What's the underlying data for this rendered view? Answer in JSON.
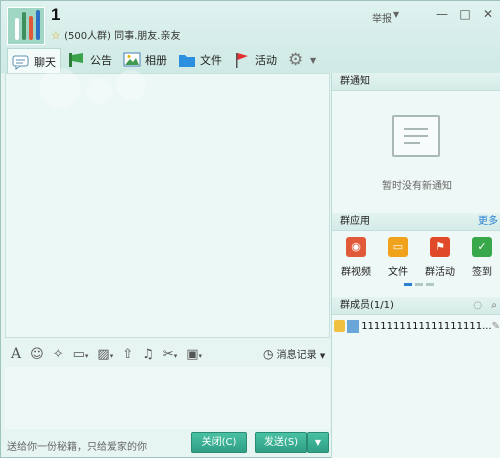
{
  "window": {
    "group_name": "1",
    "group_meta": "(500人群) 同事.朋友.亲友",
    "report_label": "举报",
    "minimize": "—",
    "maximize": "□",
    "close": "✕"
  },
  "tabs": [
    {
      "label": "聊天",
      "icon": "chat-bubble-icon"
    },
    {
      "label": "公告",
      "icon": "megaphone-icon"
    },
    {
      "label": "相册",
      "icon": "photo-album-icon"
    },
    {
      "label": "文件",
      "icon": "folder-icon"
    },
    {
      "label": "活动",
      "icon": "flag-icon"
    }
  ],
  "toolbar": {
    "icons": [
      "font-icon",
      "emoji-icon",
      "magic-wand-icon",
      "screenshot-icon",
      "image-icon",
      "upload-icon",
      "music-icon",
      "scissors-icon",
      "screen-share-icon"
    ],
    "history_label": "消息记录"
  },
  "bottom": {
    "tagline": "送给你一份秘籍，只给爱家的你",
    "close_label": "关闭(C)",
    "send_label": "发送(S)"
  },
  "notice": {
    "title": "群通知",
    "empty_text": "暂时没有新通知"
  },
  "apps": {
    "title": "群应用",
    "more_label": "更多",
    "items": [
      {
        "label": "群视频",
        "color": "#e05a3a"
      },
      {
        "label": "文件",
        "color": "#f0a21c"
      },
      {
        "label": "群活动",
        "color": "#e04a2a"
      },
      {
        "label": "签到",
        "color": "#39a84a"
      }
    ]
  },
  "members": {
    "title": "群成员(1/1)",
    "list": [
      {
        "name": "1111111111111111111..."
      }
    ]
  }
}
